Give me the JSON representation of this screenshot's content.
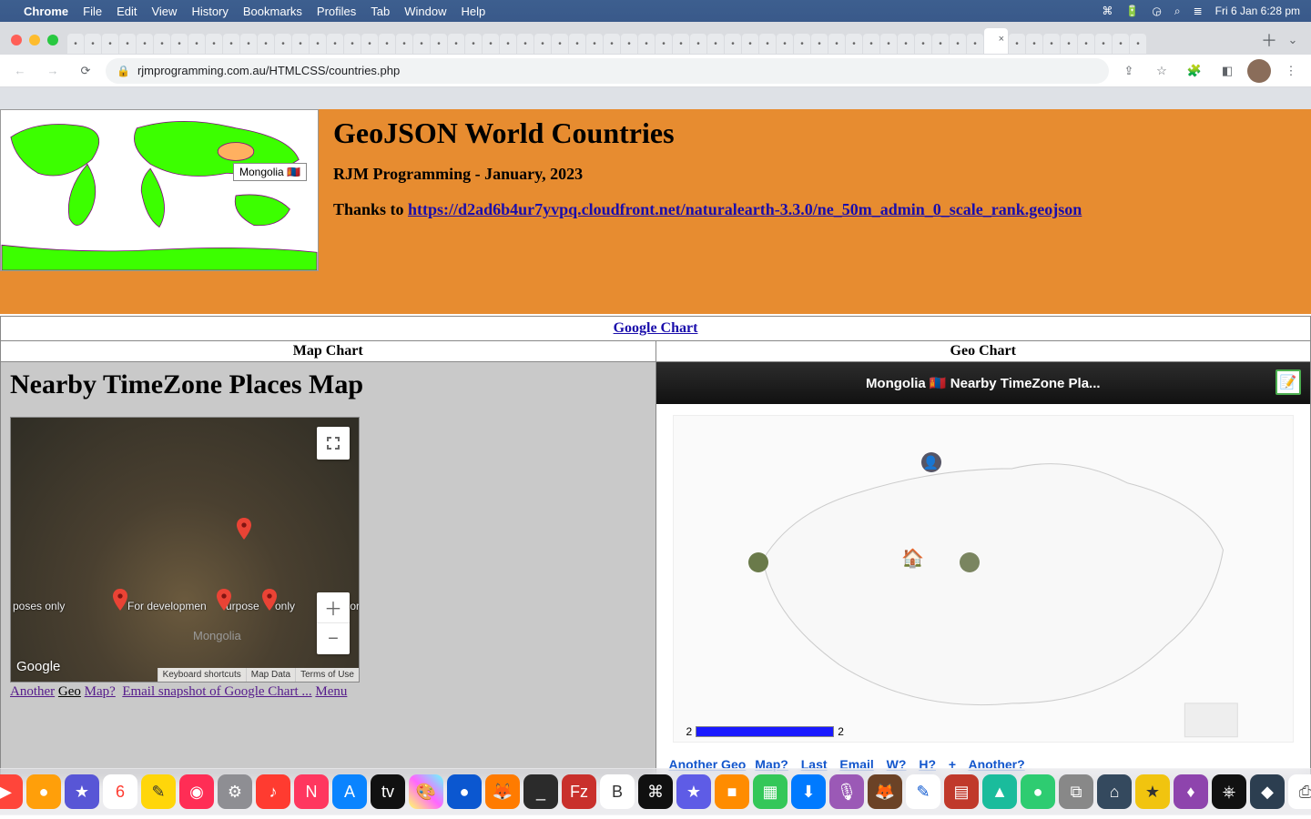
{
  "menubar": {
    "app": "Chrome",
    "items": [
      "File",
      "Edit",
      "View",
      "History",
      "Bookmarks",
      "Profiles",
      "Tab",
      "Window",
      "Help"
    ],
    "clock": "Fri 6 Jan  6:28 pm"
  },
  "omnibox": {
    "url": "rjmprogramming.com.au/HTMLCSS/countries.php"
  },
  "hero": {
    "title": "GeoJSON World Countries",
    "subtitle": "RJM Programming - January, 2023",
    "thanks_prefix": "Thanks to ",
    "thanks_link": "https://d2ad6b4ur7yvpq.cloudfront.net/naturalearth-3.3.0/ne_50m_admin_0_scale_rank.geojson",
    "tooltip": "Mongolia  🇲🇳"
  },
  "table": {
    "google_chart": "Google Chart",
    "map_chart": "Map Chart",
    "geo_chart": "Geo Chart"
  },
  "left": {
    "heading": "Nearby TimeZone Places Map",
    "dev1": "poses only",
    "dev2": "For developmen",
    "dev3": "urpose",
    "dev4": "only",
    "dev5": "For",
    "country_label": "Mongolia",
    "google": "Google",
    "kb": "Keyboard shortcuts",
    "mapdata": "Map Data",
    "terms": "Terms of Use",
    "under": {
      "another": "Another",
      "geo": "Geo",
      "map": "Map?",
      "email": "Email snapshot of Google Chart ...",
      "menu": "Menu"
    }
  },
  "right": {
    "title": "Mongolia 🇲🇳 Nearby TimeZone Pla...",
    "legend_lo": "2",
    "legend_hi": "2",
    "links": {
      "another_geo": "Another Geo",
      "map": "Map?",
      "last": "Last",
      "email": "Email",
      "w": "W?",
      "h": "H?",
      "plus": "+",
      "another": "Another?"
    }
  }
}
